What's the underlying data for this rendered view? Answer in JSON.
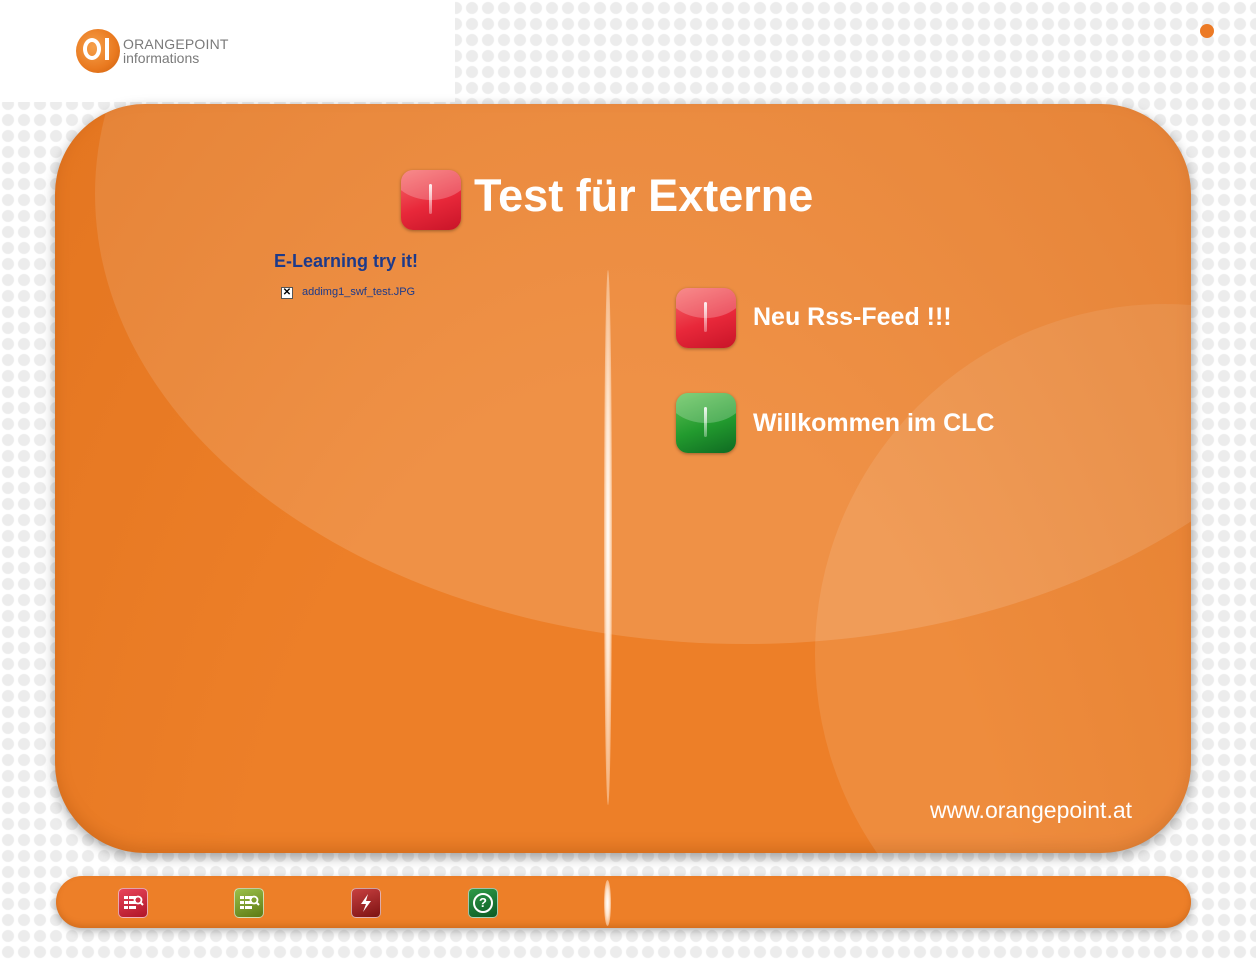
{
  "logo": {
    "line1": "ORANGEPOINT",
    "line2": "informations"
  },
  "header": {
    "title": "Test für Externe",
    "title_icon": "red-gem-icon"
  },
  "left_column": {
    "heading": "E-Learning try it!",
    "image_filename": "addimg1_swf_test.JPG",
    "broken_image_icon": "broken-image-icon"
  },
  "news": [
    {
      "title": "Neu Rss-Feed !!!",
      "icon": "red-gem-icon"
    },
    {
      "title": "Willkommen im CLC",
      "icon": "green-gem-icon"
    }
  ],
  "footer": {
    "url": "www.orangepoint.at"
  },
  "toolbar": {
    "items": [
      {
        "icon": "list-search-icon"
      },
      {
        "icon": "folder-search-icon"
      },
      {
        "icon": "flash-icon"
      },
      {
        "icon": "help-icon",
        "glyph": "?"
      }
    ]
  },
  "colors": {
    "panel": "#ed7f28",
    "heading_blue": "#1d3a8a",
    "accent_red": "#e8283a",
    "accent_green": "#229a2e"
  }
}
